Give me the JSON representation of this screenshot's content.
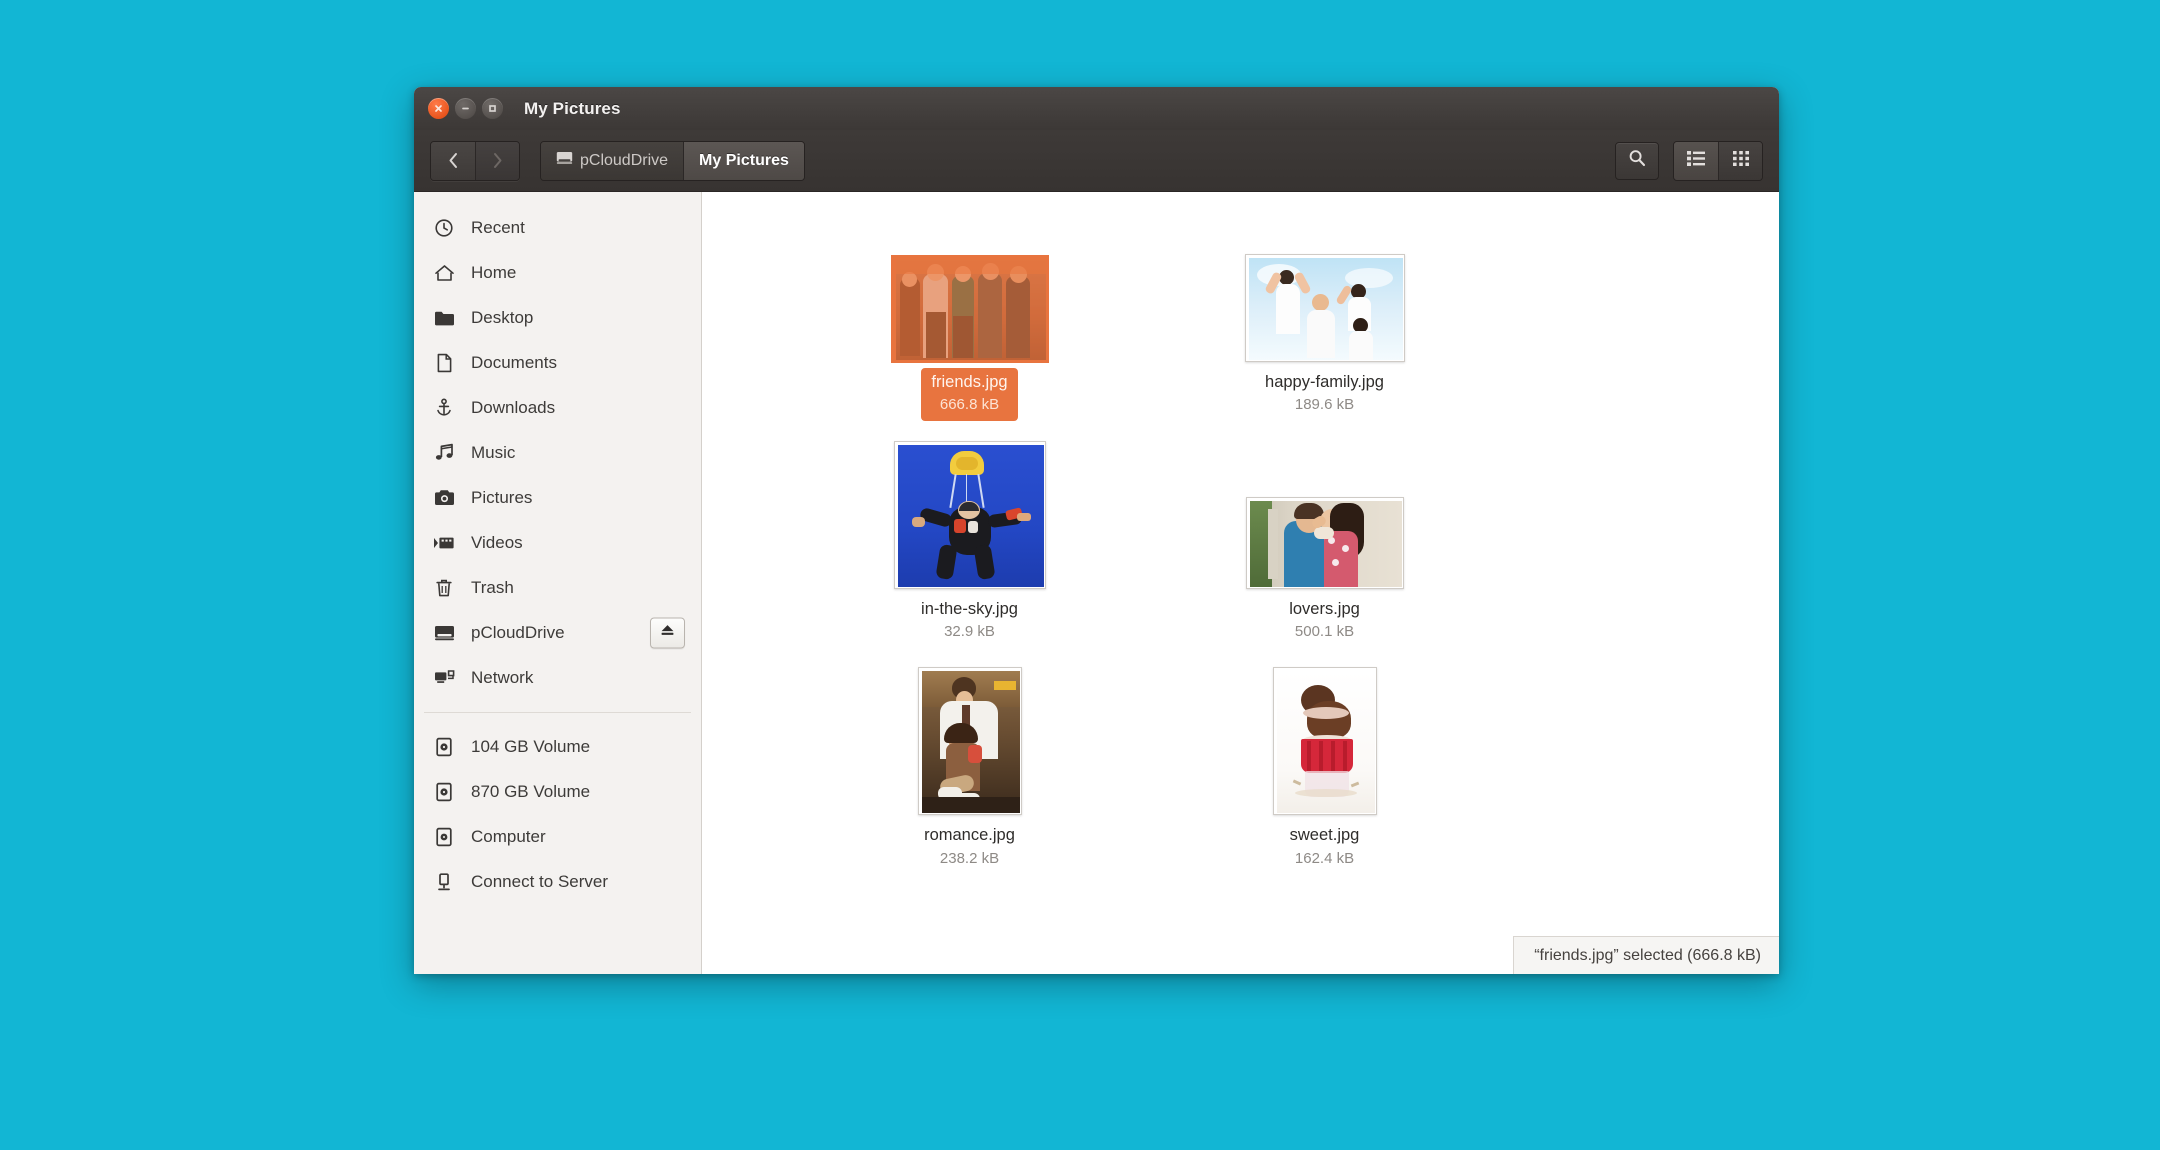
{
  "desktop": {
    "background_color": "#12b6d4"
  },
  "window": {
    "title": "My Pictures",
    "controls": {
      "close": "close-button",
      "minimize": "minimize-button",
      "maximize": "maximize-button"
    }
  },
  "toolbar": {
    "back_label": "‹",
    "forward_label": "›",
    "breadcrumbs": [
      {
        "label": "pCloudDrive",
        "icon": "drive-icon",
        "active": false
      },
      {
        "label": "My Pictures",
        "icon": "",
        "active": true
      }
    ],
    "search_label": "search-icon",
    "view_list_label": "list-view-icon",
    "view_grid_label": "grid-view-icon"
  },
  "sidebar": {
    "items": [
      {
        "label": "Recent",
        "icon": "clock-icon"
      },
      {
        "label": "Home",
        "icon": "home-icon"
      },
      {
        "label": "Desktop",
        "icon": "folder-icon"
      },
      {
        "label": "Documents",
        "icon": "document-icon"
      },
      {
        "label": "Downloads",
        "icon": "download-icon"
      },
      {
        "label": "Music",
        "icon": "music-note-icon"
      },
      {
        "label": "Pictures",
        "icon": "camera-icon"
      },
      {
        "label": "Videos",
        "icon": "video-icon"
      },
      {
        "label": "Trash",
        "icon": "trash-icon"
      },
      {
        "label": "pCloudDrive",
        "icon": "drive-icon",
        "eject": true
      },
      {
        "label": "Network",
        "icon": "network-icon"
      }
    ],
    "devices": [
      {
        "label": "104 GB Volume",
        "icon": "volume-icon"
      },
      {
        "label": "870 GB Volume",
        "icon": "volume-icon"
      },
      {
        "label": "Computer",
        "icon": "computer-icon"
      },
      {
        "label": "Connect to Server",
        "icon": "server-icon"
      }
    ]
  },
  "files": [
    {
      "name": "friends.jpg",
      "size": "666.8 kB",
      "selected": true,
      "orientation": "landscape"
    },
    {
      "name": "happy-family.jpg",
      "size": "189.6 kB",
      "selected": false,
      "orientation": "landscape"
    },
    {
      "name": "in-the-sky.jpg",
      "size": "32.9 kB",
      "selected": false,
      "orientation": "square"
    },
    {
      "name": "lovers.jpg",
      "size": "500.1 kB",
      "selected": false,
      "orientation": "landscape"
    },
    {
      "name": "romance.jpg",
      "size": "238.2 kB",
      "selected": false,
      "orientation": "portrait"
    },
    {
      "name": "sweet.jpg",
      "size": "162.4 kB",
      "selected": false,
      "orientation": "portrait"
    }
  ],
  "statusbar": {
    "text": "“friends.jpg” selected  (666.8 kB)"
  },
  "colors": {
    "desktop": "#12b6d4",
    "selection": "#e8743f",
    "titlebar": "#3c3836",
    "sidebar": "#f4f2f0"
  }
}
